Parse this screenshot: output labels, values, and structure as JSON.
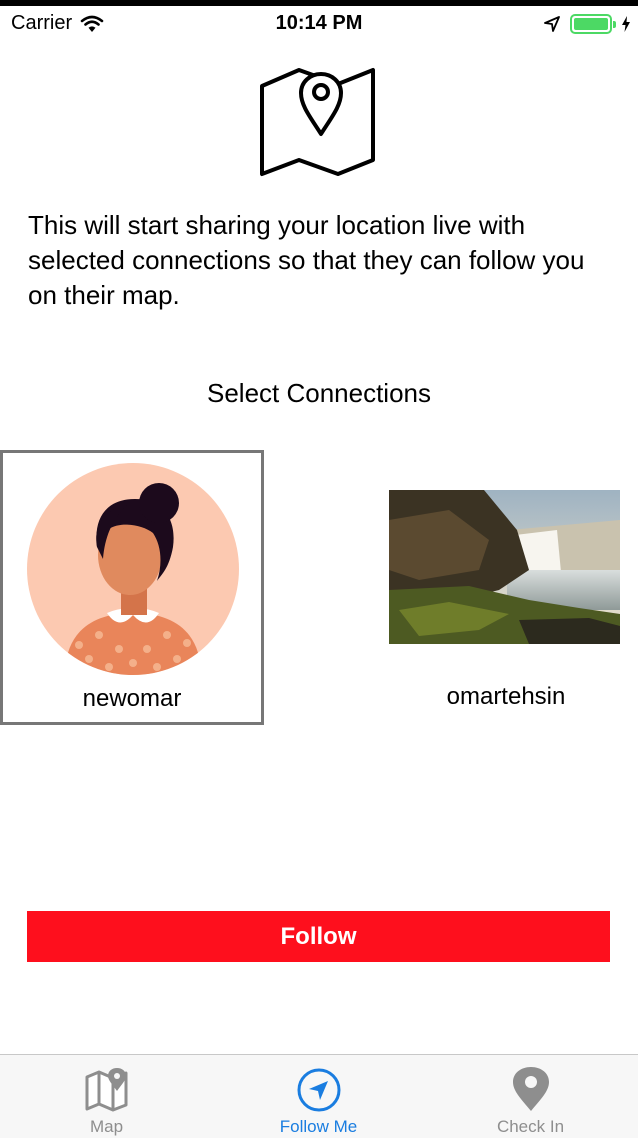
{
  "status_bar": {
    "carrier": "Carrier",
    "time": "10:14 PM",
    "battery_level": 1.0,
    "battery_color": "#4cd964"
  },
  "header": {
    "icon": "map-pin-icon"
  },
  "description": "This will start sharing your location live with selected connections so that they can follow you on their map.",
  "section_title": "Select Connections",
  "connections": [
    {
      "name": "newomar",
      "avatar": "woman-avatar-illustration",
      "selected": true
    },
    {
      "name": "omartehsin",
      "avatar": "waterfall-photo",
      "selected": false
    }
  ],
  "follow_button": {
    "label": "Follow",
    "color": "#fe0f1d"
  },
  "tab_bar": {
    "tabs": [
      {
        "label": "Map",
        "icon": "map-icon",
        "active": false
      },
      {
        "label": "Follow Me",
        "icon": "navigation-arrow-icon",
        "active": true
      },
      {
        "label": "Check In",
        "icon": "location-pin-icon",
        "active": false
      }
    ],
    "active_color": "#1a7de0",
    "inactive_color": "#8e8e8e"
  }
}
